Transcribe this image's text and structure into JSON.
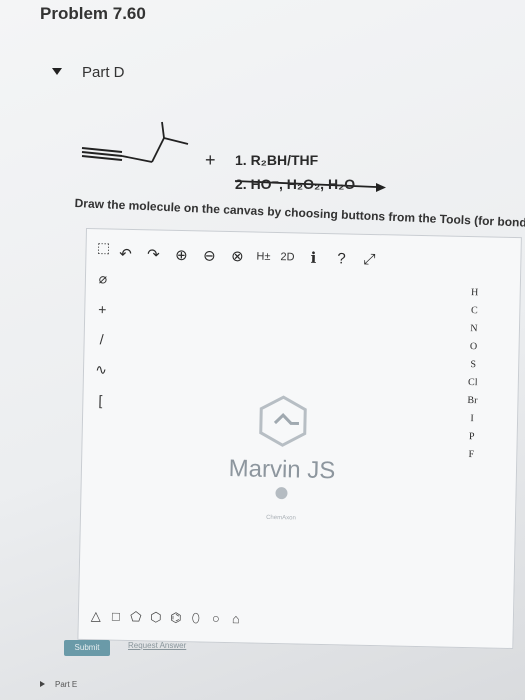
{
  "problem": {
    "title": "Problem 7.60"
  },
  "part_d": {
    "label": "Part D"
  },
  "reaction": {
    "plus": "+",
    "condition_1": "1. R₂BH/THF",
    "condition_2": "2. HO⁻, H₂O₂, H₂O"
  },
  "instructions": "Draw the molecule on the canvas by choosing buttons from the Tools (for bonds), A",
  "toolbar": {
    "h_toggle": "H±",
    "clean_2d": "2D"
  },
  "elements": [
    "H",
    "C",
    "N",
    "O",
    "S",
    "Cl",
    "Br",
    "I",
    "P",
    "F"
  ],
  "watermark": {
    "name": "Marvin JS",
    "sub": "ChemAxon"
  },
  "actions": {
    "submit": "Submit",
    "request_answer": "Request Answer"
  },
  "part_e": {
    "label": "Part E"
  },
  "colors": {
    "submit_bg": "#6a9aa8",
    "canvas_border": "#c9cdd2"
  }
}
